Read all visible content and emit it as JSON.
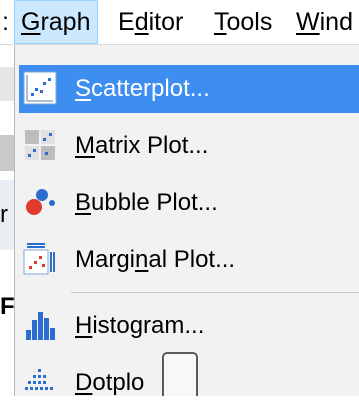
{
  "menubar": {
    "fragment": ":",
    "items": [
      {
        "acc": "G",
        "rest": "raph"
      },
      {
        "pre": "E",
        "acc": "d",
        "rest": "itor"
      },
      {
        "acc": "T",
        "rest": "ools"
      },
      {
        "acc": "W",
        "rest": "ind"
      }
    ]
  },
  "background": {
    "text1": "r",
    "text2": "F"
  },
  "dropdown": {
    "items": [
      {
        "acc": "S",
        "rest": "catterplot...",
        "icon": "scatterplot-icon",
        "selected": true
      },
      {
        "acc": "M",
        "rest": "atrix Plot...",
        "icon": "matrix-plot-icon"
      },
      {
        "acc": "B",
        "rest": "ubble Plot...",
        "icon": "bubble-plot-icon"
      },
      {
        "pre": "Margi",
        "acc": "n",
        "rest": "al Plot...",
        "icon": "marginal-plot-icon"
      },
      {
        "acc": "H",
        "rest": "istogram...",
        "icon": "histogram-icon"
      },
      {
        "acc": "D",
        "rest": "otplo",
        "icon": "dotplot-icon"
      }
    ]
  },
  "colors": {
    "selection": "#3d8ef0",
    "menu_bg": "#f2f2f2",
    "accent_red": "#e03a2f",
    "accent_blue": "#2b6ed0"
  }
}
